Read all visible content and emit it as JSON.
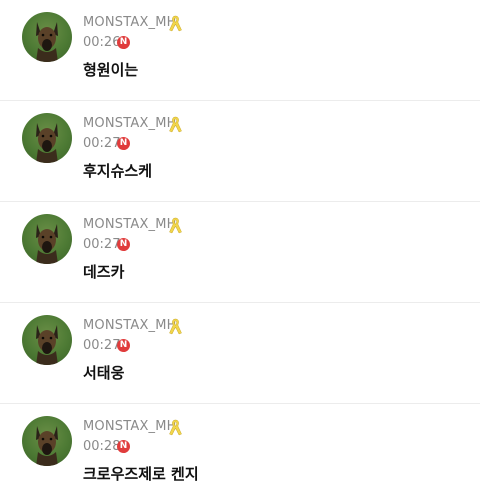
{
  "colors": {
    "username": "#8a8a8a",
    "time": "#8a8a8a",
    "badge": "#e03c3c",
    "ribbon": "#f2d64b",
    "message": "#111111",
    "divider": "#ececec"
  },
  "posts": [
    {
      "username": "MONSTAX_MH",
      "ribbon_icon": "yellow-ribbon-icon",
      "time": "00:26",
      "badge": "N",
      "message": "형원이는"
    },
    {
      "username": "MONSTAX_MH",
      "ribbon_icon": "yellow-ribbon-icon",
      "time": "00:27",
      "badge": "N",
      "message": "후지슈스케"
    },
    {
      "username": "MONSTAX_MH",
      "ribbon_icon": "yellow-ribbon-icon",
      "time": "00:27",
      "badge": "N",
      "message": "데즈카"
    },
    {
      "username": "MONSTAX_MH",
      "ribbon_icon": "yellow-ribbon-icon",
      "time": "00:27",
      "badge": "N",
      "message": "서태웅"
    },
    {
      "username": "MONSTAX_MH",
      "ribbon_icon": "yellow-ribbon-icon",
      "time": "00:28",
      "badge": "N",
      "message": "크로우즈제로 켄지"
    }
  ]
}
